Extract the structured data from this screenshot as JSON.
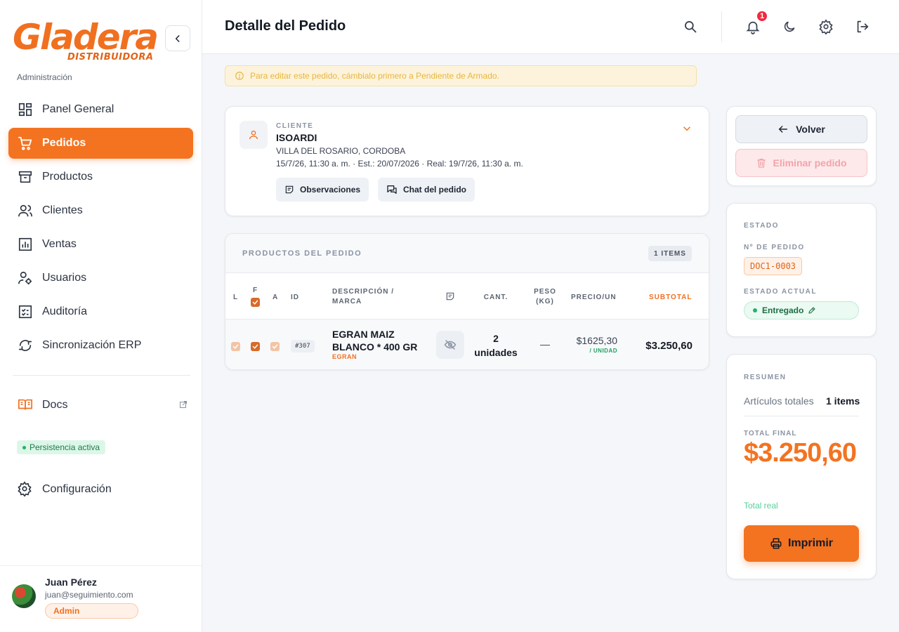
{
  "brand": {
    "logo_text": "Gladera",
    "logo_sub": "DISTRIBUIDORA",
    "section_label": "Administración",
    "accent": "#f37321"
  },
  "sidebar": {
    "items": [
      {
        "label": "Panel General",
        "icon": "dashboard-icon"
      },
      {
        "label": "Pedidos",
        "icon": "cart-icon",
        "active": true
      },
      {
        "label": "Productos",
        "icon": "archive-icon"
      },
      {
        "label": "Clientes",
        "icon": "users-icon"
      },
      {
        "label": "Ventas",
        "icon": "chart-icon"
      },
      {
        "label": "Usuarios",
        "icon": "user-cog-icon"
      },
      {
        "label": "Auditoría",
        "icon": "checklist-icon"
      },
      {
        "label": "Sincronización ERP",
        "icon": "sync-icon"
      }
    ],
    "docs_label": "Docs",
    "persistence_label": "Persistencia activa",
    "config_label": "Configuración"
  },
  "user": {
    "name": "Juan Pérez",
    "email": "juan@seguimiento.com",
    "role": "Admin"
  },
  "header": {
    "title": "Detalle del Pedido",
    "notification_count": "1"
  },
  "warning": {
    "text": "Para editar este pedido, cámbialo primero a Pendiente de Armado."
  },
  "client": {
    "label": "CLIENTE",
    "name": "ISOARDI",
    "location": "VILLA DEL ROSARIO, CORDOBA",
    "dates": "15/7/26, 11:30 a. m. · Est.: 20/07/2026 · Real: 19/7/26, 11:30 a. m.",
    "observations_label": "Observaciones",
    "chat_label": "Chat del pedido"
  },
  "products": {
    "title": "PRODUCTOS DEL PEDIDO",
    "count_badge": "1 ITEMS",
    "columns": {
      "l": "L",
      "f": "F",
      "a": "A",
      "id": "ID",
      "description_line1": "DESCRIPCIÓN /",
      "description_line2": "MARCA",
      "qty": "CANT.",
      "weight_line1": "PESO",
      "weight_line2": "(KG)",
      "price": "PRECIO/UN",
      "subtotal": "SUBTOTAL"
    },
    "rows": [
      {
        "id": "#307",
        "description_line1": "EGRAN MAIZ",
        "description_line2": "BLANCO * 400 GR",
        "brand": "EGRAN",
        "qty_line1": "2",
        "qty_line2": "unidades",
        "weight": "—",
        "price": "$1625,30",
        "price_unit": "/ UNIDAD",
        "subtotal": "$3.250,60"
      }
    ]
  },
  "actions": {
    "back_label": "Volver",
    "delete_label": "Eliminar pedido"
  },
  "state": {
    "section_label": "ESTADO",
    "order_no_label": "Nº DE PEDIDO",
    "order_no": "DOC1-0003",
    "current_label": "ESTADO ACTUAL",
    "current_value": "Entregado"
  },
  "summary": {
    "section_label": "RESUMEN",
    "articles_label": "Artículos totales",
    "articles_value": "1 items",
    "total_label": "TOTAL FINAL",
    "total_value": "$3.250,60",
    "total_note": "Total real",
    "print_label": "Imprimir"
  }
}
